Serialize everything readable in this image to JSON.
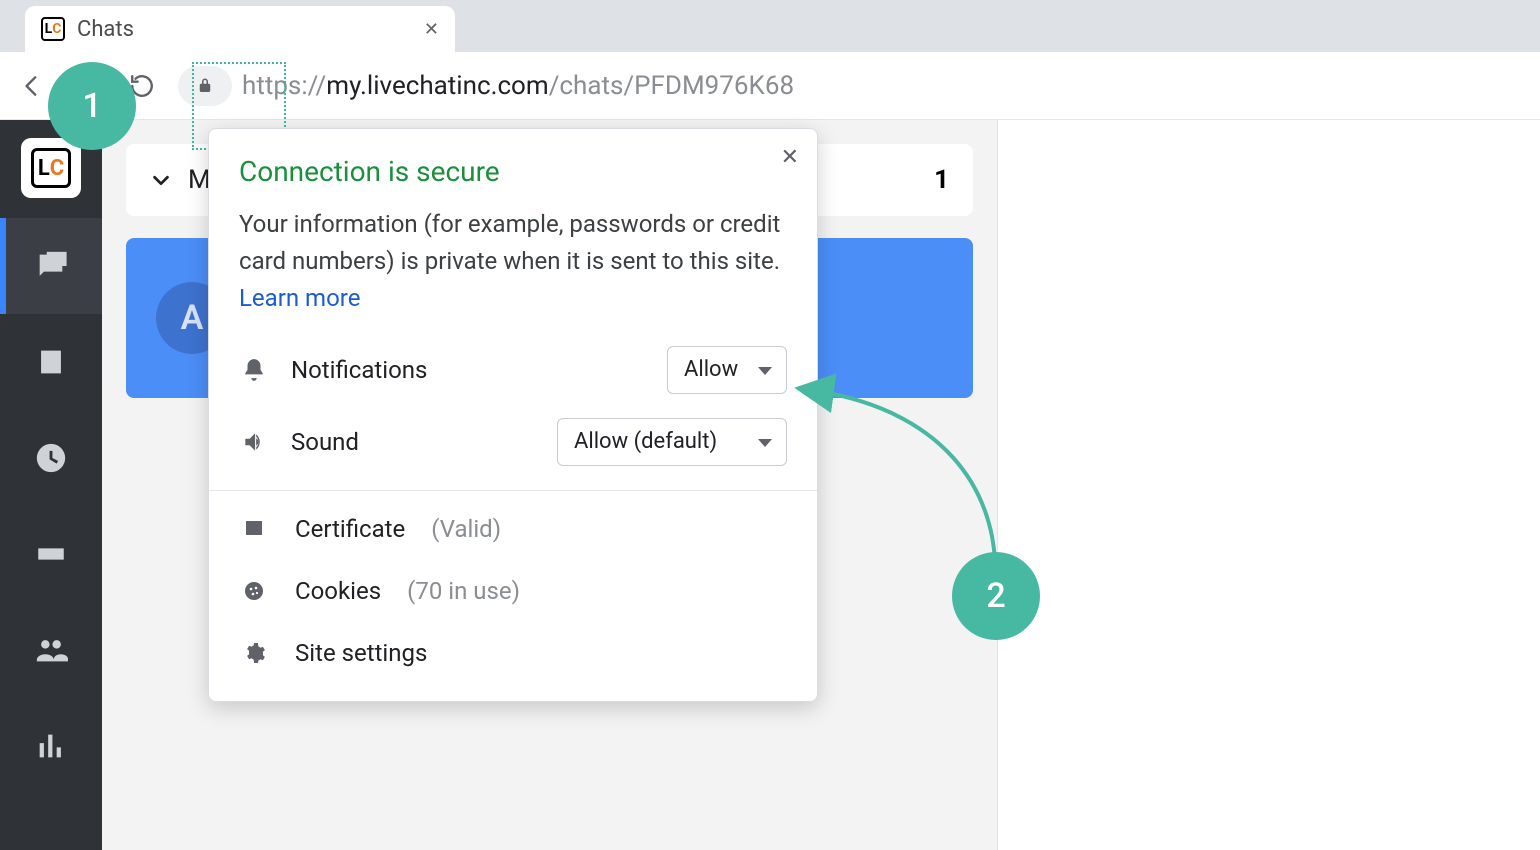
{
  "browser": {
    "tab_title": "Chats",
    "favicon_letters": {
      "l": "L",
      "c": "C"
    },
    "url_prefix": "https://",
    "url_host": "my.livechatinc.com",
    "url_path": "/chats/PFDM976K68"
  },
  "sidebar": {
    "items": [
      {
        "name": "chats",
        "active": true
      },
      {
        "name": "contacts",
        "active": false
      },
      {
        "name": "history",
        "active": false
      },
      {
        "name": "tickets",
        "active": false
      },
      {
        "name": "agents",
        "active": false
      },
      {
        "name": "reports",
        "active": false
      }
    ]
  },
  "chat_list": {
    "header_label_initial": "M",
    "count": "1",
    "item_avatar_initial": "A"
  },
  "popover": {
    "title": "Connection is secure",
    "description_pre": "Your information (for example, passwords or credit card numbers) is private when it is sent to this site. ",
    "learn_more": "Learn more",
    "permissions": {
      "notifications": {
        "label": "Notifications",
        "value": "Allow"
      },
      "sound": {
        "label": "Sound",
        "value": "Allow (default)"
      }
    },
    "certificate": {
      "label": "Certificate",
      "status": "(Valid)"
    },
    "cookies": {
      "label": "Cookies",
      "status": "(70 in use)"
    },
    "site_settings": "Site settings"
  },
  "annotations": {
    "badge1": "1",
    "badge2": "2"
  }
}
